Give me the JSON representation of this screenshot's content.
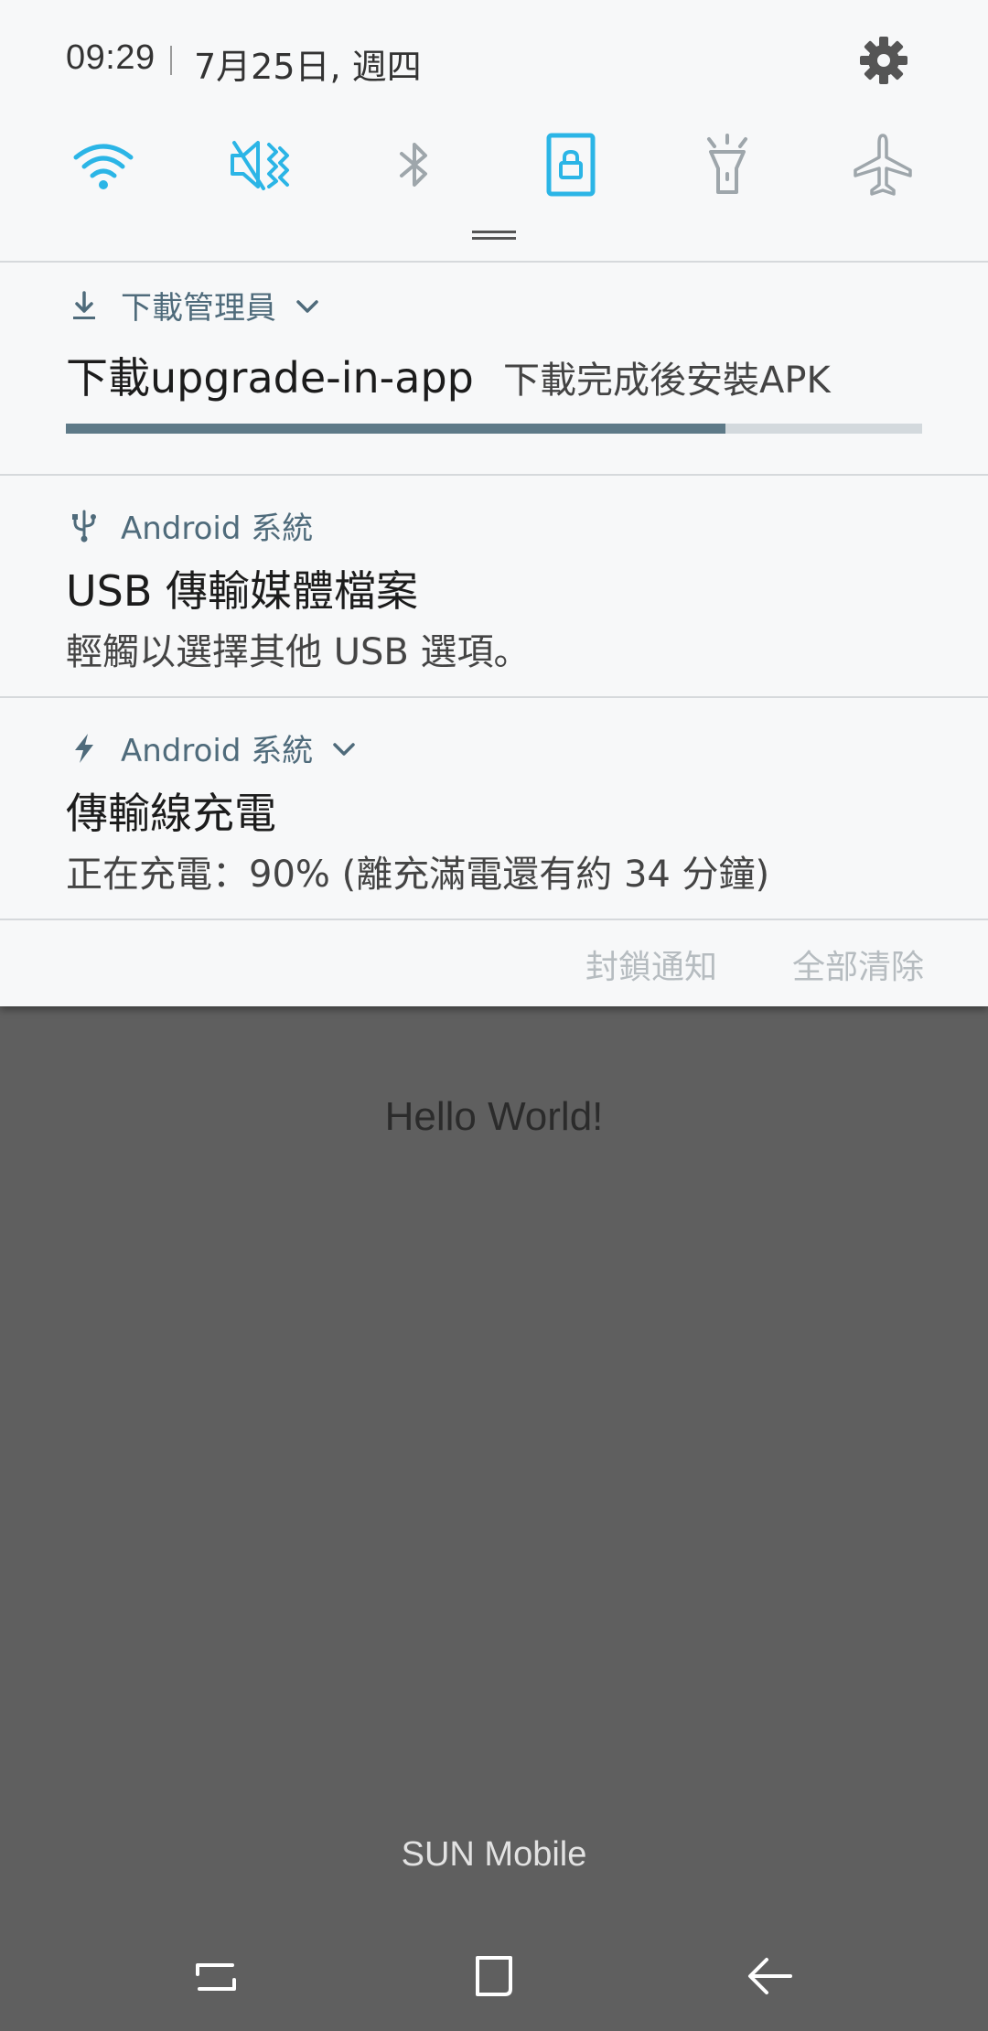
{
  "colors": {
    "accent_blue": "#2bb5e6",
    "inactive_icon": "#9ea6ab",
    "app_name": "#4f6b7b",
    "progress_fill": "#5e7a88",
    "progress_track": "#d3d9dd",
    "shade_bg": "#f7f8f9",
    "app_bg": "#5f5f5f"
  },
  "status": {
    "time": "09:29",
    "date": "7月25日, 週四",
    "settings_icon": "gear-icon"
  },
  "quick_settings": [
    {
      "name": "wifi",
      "icon": "wifi-icon",
      "active": true
    },
    {
      "name": "sound",
      "icon": "vibrate-mute-icon",
      "active": true
    },
    {
      "name": "bluetooth",
      "icon": "bluetooth-icon",
      "active": false
    },
    {
      "name": "rotation-lock",
      "icon": "portrait-lock-icon",
      "active": true
    },
    {
      "name": "flashlight",
      "icon": "flashlight-icon",
      "active": false
    },
    {
      "name": "airplane",
      "icon": "airplane-icon",
      "active": false
    }
  ],
  "notifications": [
    {
      "app": "下載管理員",
      "icon": "download-icon",
      "title": "下載upgrade-in-app",
      "subtitle": "下載完成後安裝APK",
      "progress": 0.77
    },
    {
      "app": "Android 系統",
      "icon": "usb-icon",
      "title": "USB 傳輸媒體檔案",
      "text": "輕觸以選擇其他 USB 選項。"
    },
    {
      "app": "Android 系統",
      "icon": "charging-bolt-icon",
      "title": "傳輸線充電",
      "text": "正在充電：90% (離充滿電還有約 34 分鐘)"
    }
  ],
  "actions": {
    "block": "封鎖通知",
    "clear_all": "全部清除"
  },
  "app": {
    "hello": "Hello World!",
    "carrier": "SUN Mobile"
  },
  "navbar": {
    "recents": "recents-icon",
    "home": "home-icon",
    "back": "back-icon"
  }
}
